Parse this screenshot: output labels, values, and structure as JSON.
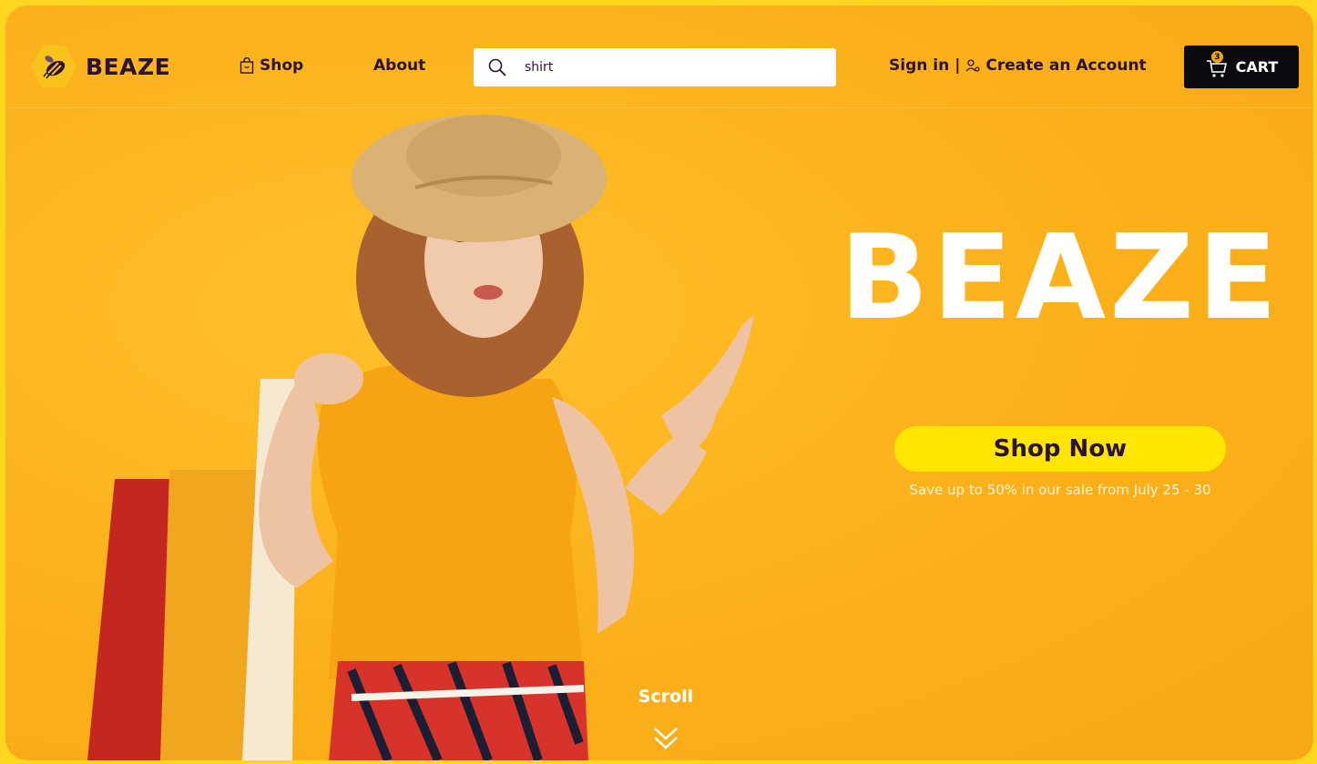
{
  "brand": {
    "name": "BEAZE",
    "logo_icon": "bee-icon"
  },
  "nav": {
    "shop_label": "Shop",
    "about_label": "About",
    "sign_in_label": "Sign in",
    "separator": "|",
    "create_account_label": "Create an Account"
  },
  "search": {
    "value": "shirt",
    "placeholder": ""
  },
  "cart": {
    "label": "CART",
    "count": "3"
  },
  "hero": {
    "title": "BEAZE",
    "cta_label": "Shop Now",
    "sale_text": "Save up to 50% in our sale from July 25 - 30",
    "scroll_label": "Scroll"
  },
  "colors": {
    "background": "#fbb21d",
    "brand_dark": "#2a1238",
    "cta": "#ffe600",
    "cart_bg": "#0b0b0f"
  }
}
